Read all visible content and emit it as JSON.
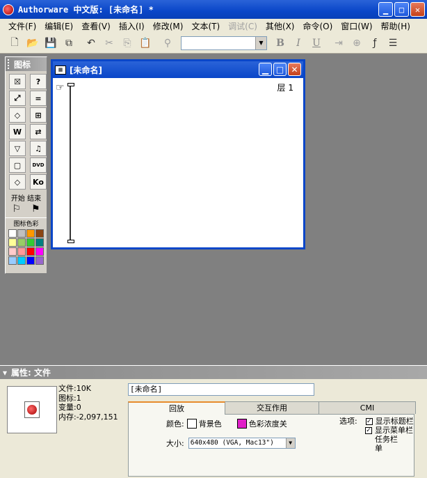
{
  "window": {
    "title": "Authorware 中文版: [未命名] *"
  },
  "menu": [
    {
      "label": "文件(F)",
      "enabled": true
    },
    {
      "label": "编辑(E)",
      "enabled": true
    },
    {
      "label": "查看(V)",
      "enabled": true
    },
    {
      "label": "插入(I)",
      "enabled": true
    },
    {
      "label": "修改(M)",
      "enabled": true
    },
    {
      "label": "文本(T)",
      "enabled": true
    },
    {
      "label": "调试(C)",
      "enabled": false
    },
    {
      "label": "其他(X)",
      "enabled": true
    },
    {
      "label": "命令(O)",
      "enabled": true
    },
    {
      "label": "窗口(W)",
      "enabled": true
    },
    {
      "label": "帮助(H)",
      "enabled": true
    }
  ],
  "toolbar": {
    "font_value": "",
    "bold": "B",
    "italic": "I",
    "underline": "U"
  },
  "palette": {
    "title": "图标",
    "icons": [
      {
        "name": "display-icon",
        "glyph": "☒"
      },
      {
        "name": "interaction-icon",
        "glyph": "?"
      },
      {
        "name": "motion-icon",
        "glyph": "⤢"
      },
      {
        "name": "calculation-icon",
        "glyph": "="
      },
      {
        "name": "erase-icon",
        "glyph": "◇"
      },
      {
        "name": "framework-icon",
        "glyph": "⊞"
      },
      {
        "name": "wait-icon",
        "glyph": "W"
      },
      {
        "name": "navigate-icon",
        "glyph": "⇄"
      },
      {
        "name": "decision-icon",
        "glyph": "▽"
      },
      {
        "name": "sound-icon",
        "glyph": "♫"
      },
      {
        "name": "map-icon",
        "glyph": "▢"
      },
      {
        "name": "dvd-icon",
        "glyph": "DVD"
      },
      {
        "name": "branch-icon",
        "glyph": "◇"
      },
      {
        "name": "knowledge-object-icon",
        "glyph": "Ko"
      }
    ],
    "start_end_label": "开始 结束",
    "color_label": "图标色彩",
    "swatches": [
      "#ffffff",
      "#c0c0c0",
      "#ff9900",
      "#8b4513",
      "#ffff99",
      "#99cc66",
      "#33cc33",
      "#008080",
      "#ffcccc",
      "#ff9999",
      "#ff0000",
      "#ff00ff",
      "#99ccff",
      "#00ccff",
      "#0000ff",
      "#9966cc"
    ]
  },
  "flow_window": {
    "title": "[未命名]",
    "layer": "层 1"
  },
  "properties": {
    "title": "属性: 文件",
    "file_info": [
      "文件:10K",
      "图标:1",
      "变量:0",
      "内存:-2,097,151"
    ],
    "name_value": "[未命名]",
    "tabs": [
      "回放",
      "交互作用",
      "CMI"
    ],
    "color_label": "颜色:",
    "background_label": "背景色",
    "chroma_label": "色彩浓度关",
    "chroma_color": "#e020c8",
    "size_label": "大小:",
    "size_value": "640x480 (VGA, Mac13\")",
    "options_label": "选项:",
    "options": [
      {
        "label": "显示标题栏",
        "checked": true
      },
      {
        "label": "显示菜单栏",
        "checked": true
      },
      {
        "label": "任务栏",
        "checked": false
      },
      {
        "label": "单",
        "checked": false
      }
    ]
  }
}
